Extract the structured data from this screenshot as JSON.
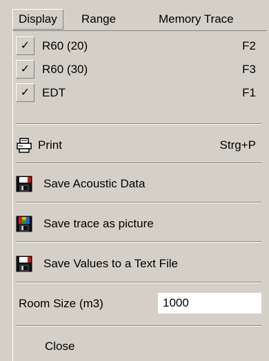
{
  "menubar": {
    "tabs": [
      {
        "label": "Display"
      },
      {
        "label": "Range"
      },
      {
        "label": "Memory Trace"
      }
    ]
  },
  "menu": {
    "items": [
      {
        "label": "R60 (20)",
        "shortcut": "F2",
        "checked": true
      },
      {
        "label": "R60 (30)",
        "shortcut": "F3",
        "checked": true
      },
      {
        "label": "EDT",
        "shortcut": "F1",
        "checked": true
      }
    ],
    "check_glyph": "✓",
    "print": {
      "label": "Print",
      "shortcut": "Strg+P",
      "icon": "printer-icon"
    },
    "save_acoustic": {
      "label": "Save Acoustic Data",
      "icon": "floppy-disk-icon",
      "accent": "#e01010"
    },
    "save_trace": {
      "label": "Save trace as picture",
      "icon": "floppy-picture-icon",
      "accent": "#20a020"
    },
    "save_values": {
      "label": "Save Values to a Text File",
      "icon": "floppy-disk-icon",
      "accent": "#e01010"
    },
    "room_size": {
      "label": "Room Size (m3)",
      "value": "1000"
    },
    "close": {
      "label": "Close"
    }
  },
  "colors": {
    "face": "#d4d0c8",
    "shadow": "#808080",
    "highlight": "#ffffff"
  }
}
